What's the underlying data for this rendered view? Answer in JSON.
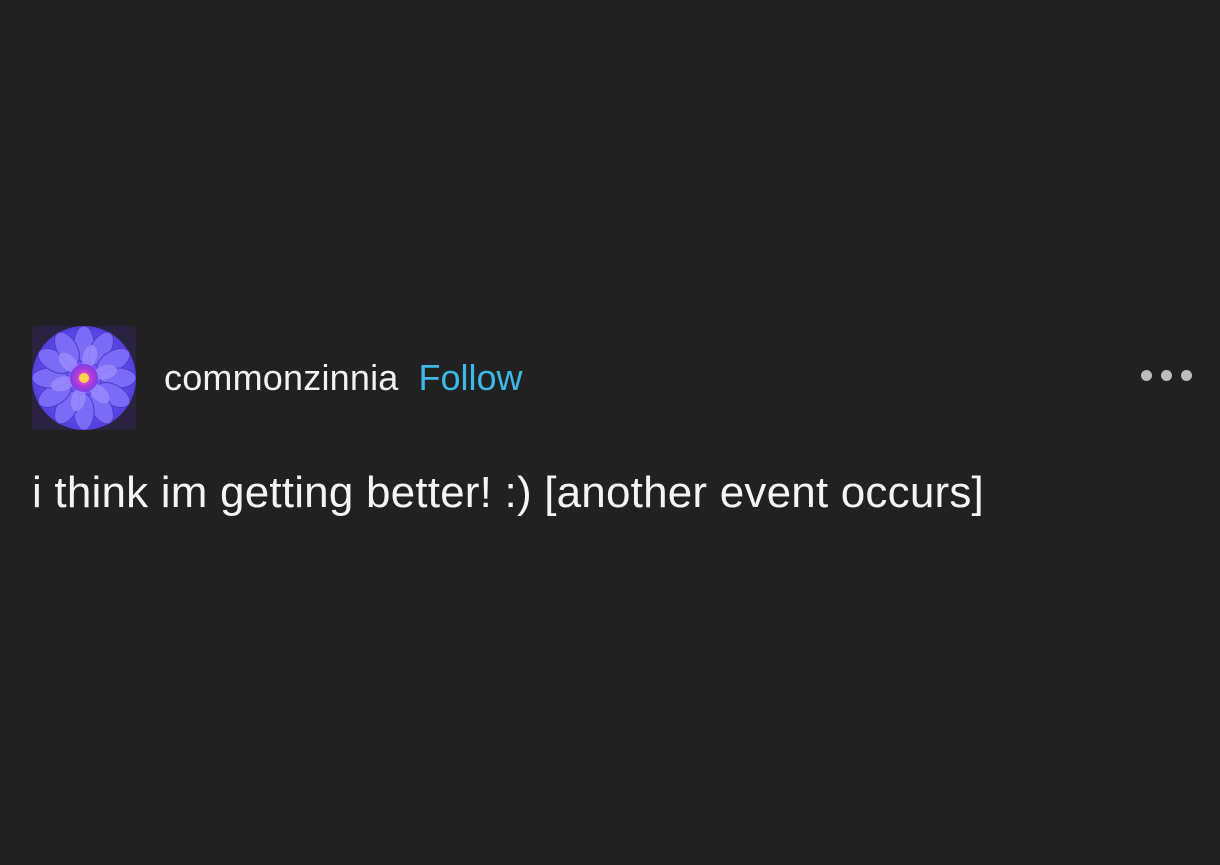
{
  "post": {
    "username": "commonzinnia",
    "follow_label": "Follow",
    "more_icon": "more-horizontal-icon",
    "avatar_icon": "zinnia-flower-avatar",
    "text": "i think im getting better! :) [another event occurs]"
  },
  "colors": {
    "background": "#212121",
    "text": "#f4f4f4",
    "follow": "#3db8e8",
    "avatar_petals": "#6a4cf0"
  }
}
